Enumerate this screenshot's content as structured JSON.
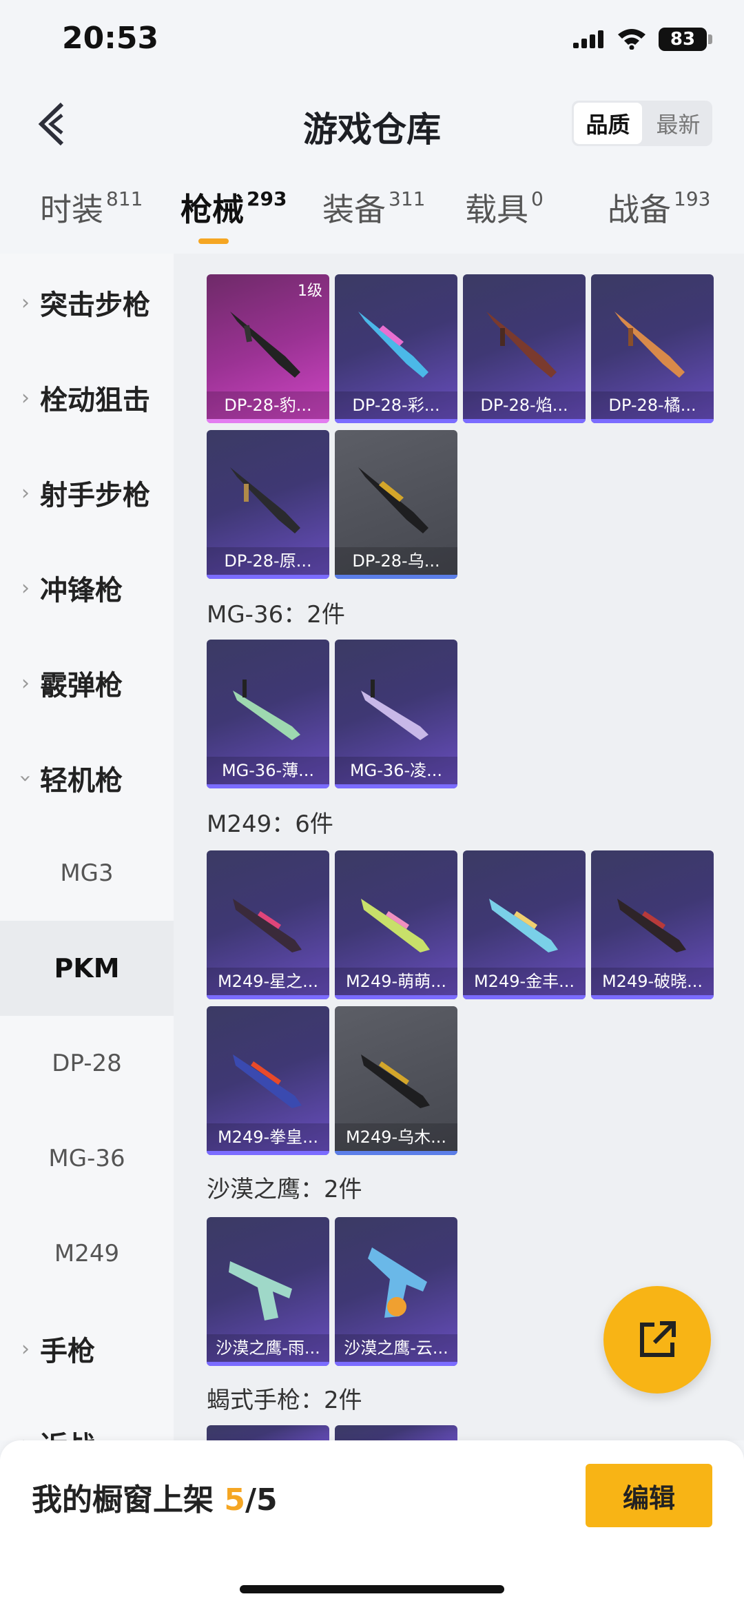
{
  "status": {
    "time": "20:53",
    "battery": "83"
  },
  "header": {
    "title": "游戏仓库",
    "sort": [
      "品质",
      "最新"
    ],
    "sort_active": 0
  },
  "tabs": [
    {
      "label": "时装",
      "count": "811"
    },
    {
      "label": "枪械",
      "count": "293"
    },
    {
      "label": "装备",
      "count": "311"
    },
    {
      "label": "载具",
      "count": "0"
    },
    {
      "label": "战备",
      "count": "193"
    }
  ],
  "sidebar": {
    "categories": [
      "突击步枪",
      "栓动狙击",
      "射手步枪",
      "冲锋枪",
      "霰弹枪",
      "轻机枪"
    ],
    "sub_items": [
      "MG3",
      "PKM",
      "DP-28",
      "MG-36",
      "M249"
    ],
    "active_sub": "PKM",
    "more": [
      "手枪",
      "近战"
    ]
  },
  "sections": [
    {
      "title": "",
      "cards": [
        {
          "name": "DP-28-豹...",
          "level": "1级"
        },
        {
          "name": "DP-28-彩..."
        },
        {
          "name": "DP-28-焰..."
        },
        {
          "name": "DP-28-橘..."
        },
        {
          "name": "DP-28-原..."
        },
        {
          "name": "DP-28-乌..."
        }
      ]
    },
    {
      "title": "MG-36：2件",
      "cards": [
        {
          "name": "MG-36-薄..."
        },
        {
          "name": "MG-36-凌..."
        }
      ]
    },
    {
      "title": "M249：6件",
      "cards": [
        {
          "name": "M249-星之..."
        },
        {
          "name": "M249-萌萌..."
        },
        {
          "name": "M249-金丰..."
        },
        {
          "name": "M249-破晓..."
        },
        {
          "name": "M249-拳皇..."
        },
        {
          "name": "M249-乌木..."
        }
      ]
    },
    {
      "title": "沙漠之鹰：2件",
      "cards": [
        {
          "name": "沙漠之鹰-雨..."
        },
        {
          "name": "沙漠之鹰-云..."
        }
      ]
    },
    {
      "title": "蝎式手枪：2件",
      "cards": []
    }
  ],
  "bottom": {
    "shelf_label": "我的橱窗上架",
    "current": "5",
    "total": "/5",
    "edit_label": "编辑"
  }
}
